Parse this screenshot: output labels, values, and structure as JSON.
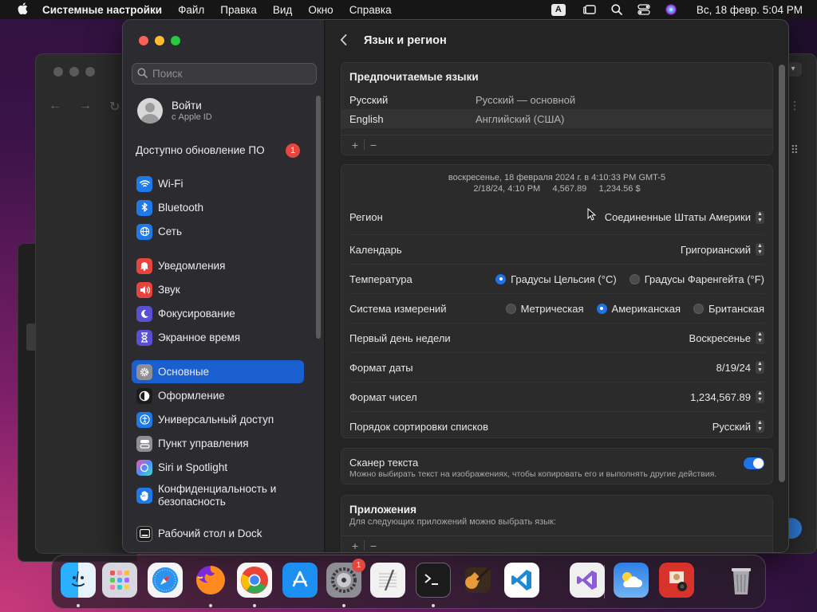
{
  "menubar": {
    "app_name": "Системные настройки",
    "menus": [
      "Файл",
      "Правка",
      "Вид",
      "Окно",
      "Справка"
    ],
    "input_badge": "A",
    "clock": "Вс, 18 февр.  5:04 PM"
  },
  "sidebar": {
    "search_placeholder": "Поиск",
    "profile": {
      "title": "Войти",
      "subtitle": "с Apple ID"
    },
    "update": {
      "label": "Доступно обновление ПО",
      "badge": "1"
    },
    "items": [
      {
        "label": "Wi-Fi",
        "icon": "wifi-icon",
        "color": "#1f7ae8"
      },
      {
        "label": "Bluetooth",
        "icon": "bluetooth-icon",
        "color": "#1f7ae8"
      },
      {
        "label": "Сеть",
        "icon": "globe-icon",
        "color": "#1f7ae8"
      },
      {
        "label": "Уведомления",
        "icon": "bell-icon",
        "color": "#e5453d"
      },
      {
        "label": "Звук",
        "icon": "speaker-icon",
        "color": "#e5453d"
      },
      {
        "label": "Фокусирование",
        "icon": "moon-icon",
        "color": "#5b4fd6"
      },
      {
        "label": "Экранное время",
        "icon": "hourglass-icon",
        "color": "#5b4fd6"
      },
      {
        "label": "Основные",
        "icon": "gear-icon",
        "color": "#8e8e93"
      },
      {
        "label": "Оформление",
        "icon": "appearance-icon",
        "color": "#1c1c1c"
      },
      {
        "label": "Универсальный доступ",
        "icon": "accessibility-icon",
        "color": "#1f7ae8"
      },
      {
        "label": "Пункт управления",
        "icon": "control-center-icon",
        "color": "#8e8e93"
      },
      {
        "label": "Siri и Spotlight",
        "icon": "siri-icon",
        "color": "#b03fd6"
      },
      {
        "label": "Конфиденциальность и безопасность",
        "icon": "hand-icon",
        "color": "#1f7ae8"
      },
      {
        "label": "Рабочий стол и Dock",
        "icon": "dock-icon",
        "color": "#1c1c1c"
      }
    ]
  },
  "content": {
    "title": "Язык и регион",
    "preferred_languages": {
      "title": "Предпочитаемые языки",
      "rows": [
        {
          "name": "Русский",
          "detail": "Русский — основной"
        },
        {
          "name": "English",
          "detail": "Английский (США)"
        }
      ]
    },
    "format_preview": {
      "line1": "воскресенье, 18 февраля 2024 г. в 4:10:33 PM GMT-5",
      "line2": "2/18/24, 4:10 PM     4,567.89     1,234.56 $"
    },
    "settings": {
      "region": {
        "label": "Регион",
        "value": "Соединенные Штаты Америки"
      },
      "calendar": {
        "label": "Календарь",
        "value": "Григорианский"
      },
      "temperature": {
        "label": "Температура",
        "option_c": "Градусы Цельсия (°C)",
        "option_f": "Градусы Фаренгейта (°F)",
        "selected": "c"
      },
      "measurement": {
        "label": "Система измерений",
        "option_metric": "Метрическая",
        "option_us": "Американская",
        "option_uk": "Британская",
        "selected": "us"
      },
      "first_day": {
        "label": "Первый день недели",
        "value": "Воскресенье"
      },
      "date_format": {
        "label": "Формат даты",
        "value": "8/19/24"
      },
      "number_format": {
        "label": "Формат чисел",
        "value": "1,234,567.89"
      },
      "sort_order": {
        "label": "Порядок сортировки списков",
        "value": "Русский"
      }
    },
    "live_text": {
      "title": "Сканер текста",
      "description": "Можно выбирать текст на изображениях, чтобы копировать его и выполнять другие действия.",
      "enabled": true
    },
    "apps": {
      "title": "Приложения",
      "description": "Для следующих приложений можно выбрать язык:"
    }
  },
  "dock": {
    "apps": [
      {
        "name": "finder",
        "color": "#1a8cf0",
        "glyph": "☺"
      },
      {
        "name": "launchpad",
        "color": "#c9c9d6",
        "glyph": "⊞"
      },
      {
        "name": "safari",
        "color": "#2a92f0",
        "glyph": "◎"
      },
      {
        "name": "firefox",
        "color": "#e8602a",
        "glyph": "●"
      },
      {
        "name": "chrome",
        "color": "#f0f0f0",
        "glyph": "◉"
      },
      {
        "name": "app-store",
        "color": "#1b8ff2",
        "glyph": "A"
      },
      {
        "name": "system-settings",
        "color": "#8d8d94",
        "glyph": "⚙",
        "badge": "1"
      },
      {
        "name": "textedit",
        "color": "#f2f2f2",
        "glyph": "✎"
      },
      {
        "name": "terminal",
        "color": "#1b1b1b",
        "glyph": ">_"
      },
      {
        "name": "garageband",
        "color": "#d8842a",
        "glyph": "♪"
      },
      {
        "name": "vscode",
        "color": "#ffffff",
        "glyph": "❮❯"
      },
      {
        "name": "visual-studio",
        "color": "#f0f0f0",
        "glyph": "∞"
      },
      {
        "name": "weather",
        "color": "#3a8ff0",
        "glyph": "☁"
      },
      {
        "name": "photo-booth",
        "color": "#d8332a",
        "glyph": "◼"
      },
      {
        "name": "trash",
        "color": "#8f8f94",
        "glyph": "🗑"
      }
    ]
  }
}
